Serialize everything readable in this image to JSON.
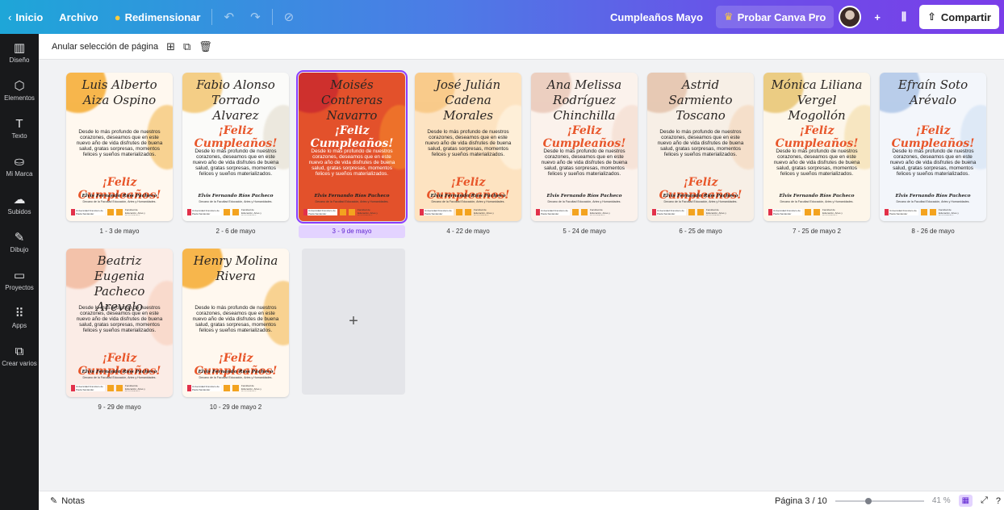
{
  "topbar": {
    "home": "Inicio",
    "file": "Archivo",
    "resize": "Redimensionar",
    "undo_icon": "undo-icon",
    "redo_icon": "redo-icon",
    "save_icon": "cloud-check-icon",
    "doc_title": "Cumpleaños Mayo",
    "pro": "Probar Canva Pro",
    "plus": "+",
    "share": "Compartir"
  },
  "rail": [
    {
      "label": "Diseño",
      "icon": "▥"
    },
    {
      "label": "Elementos",
      "icon": "⬡"
    },
    {
      "label": "Texto",
      "icon": "T"
    },
    {
      "label": "Mi Marca",
      "icon": "⛀"
    },
    {
      "label": "Subidos",
      "icon": "☁"
    },
    {
      "label": "Dibujo",
      "icon": "✎"
    },
    {
      "label": "Proyectos",
      "icon": "▭"
    },
    {
      "label": "Apps",
      "icon": "⠿"
    },
    {
      "label": "Crear varios",
      "icon": "⧉"
    }
  ],
  "selection": {
    "label": "Anular selección de página"
  },
  "pages": [
    {
      "name": "Luis Alberto Aiza Ospino",
      "caption": "1 - 3 de mayo",
      "theme": "orange",
      "layout": "a"
    },
    {
      "name": "Fabio Alonso Torrado Alvarez",
      "caption": "2 - 6 de mayo",
      "theme": "white",
      "layout": "b"
    },
    {
      "name": "Moisés Contreras Navarro",
      "caption": "3 - 9 de mayo",
      "theme": "red",
      "layout": "b",
      "selected": true
    },
    {
      "name": "José Julián Cadena Morales",
      "caption": "4 - 22 de mayo",
      "theme": "peach",
      "layout": "a"
    },
    {
      "name": "Ana Melissa Rodríguez Chinchilla",
      "caption": "5 - 24 de mayo",
      "theme": "floral",
      "layout": "b"
    },
    {
      "name": "Astrid Sarmiento Toscano",
      "caption": "6 - 25 de mayo",
      "theme": "rose",
      "layout": "a"
    },
    {
      "name": "Mónica Liliana Vergel Mogollón",
      "caption": "7 - 25 de mayo 2",
      "theme": "gold",
      "layout": "b"
    },
    {
      "name": "Efraín Soto Arévalo",
      "caption": "8 - 26 de mayo",
      "theme": "blue",
      "layout": "b"
    },
    {
      "name": "Beatriz Eugenia Pacheco Arevalo",
      "caption": "9 - 29 de mayo",
      "theme": "blush",
      "layout": "a"
    },
    {
      "name": "Henry Molina Rivera",
      "caption": "10 - 29 de mayo 2",
      "theme": "orange",
      "layout": "a"
    }
  ],
  "card_text": {
    "body": "Desde lo más profundo de nuestros corazones, deseamos que en este nuevo año de vida disfrutes de buena salud, gratas sorpresas, momentos felices y sueños materializados.",
    "feliz": "¡Feliz Cumpleaños!",
    "signer": "Elvis Fernando Ríos Pacheco",
    "role": "Decano de la Facultad Educación, Artes y Humanidades.",
    "logo_univ": "Universidad Francisco de Paula Santander",
    "logo_fac": "Facultad de Educación, Artes y Humanidades"
  },
  "add_page": "+",
  "bottombar": {
    "notes": "Notas",
    "page_indicator": "Página 3 / 10",
    "zoom": "41 %",
    "zoom_level": 0.41
  }
}
